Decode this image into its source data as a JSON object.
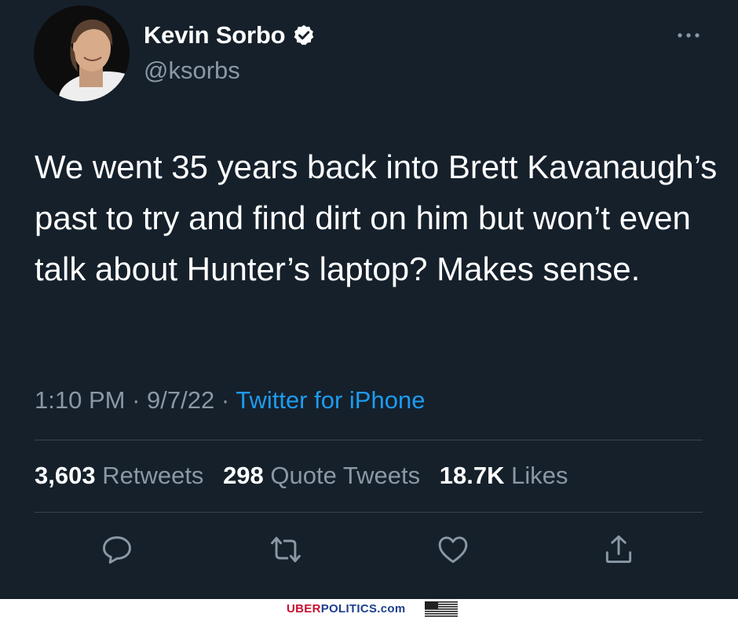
{
  "tweet": {
    "display_name": "Kevin Sorbo",
    "handle": "@ksorbs",
    "text": "We went 35 years back into Brett Kavanaugh’s past to try and find dirt on him but won’t even talk about Hunter’s laptop? Makes sense.",
    "time": "1:10 PM",
    "separator": " · ",
    "date": "9/7/22",
    "source": "Twitter for iPhone"
  },
  "stats": {
    "retweets_count": "3,603",
    "retweets_label": "Retweets",
    "quotes_count": "298",
    "quotes_label": "Quote Tweets",
    "likes_count": "18.7K",
    "likes_label": "Likes"
  },
  "icons": {
    "verified": "verified-badge-icon",
    "more": "more-options-icon",
    "reply": "reply-icon",
    "retweet": "retweet-icon",
    "like": "heart-icon",
    "share": "share-icon"
  },
  "colors": {
    "background": "#15202b",
    "secondary_text": "#8b98a5",
    "link": "#1d9bf0",
    "divider": "#38444d"
  },
  "watermark": {
    "brand_part1": "UBER",
    "brand_part2": "POLITICS.com"
  }
}
